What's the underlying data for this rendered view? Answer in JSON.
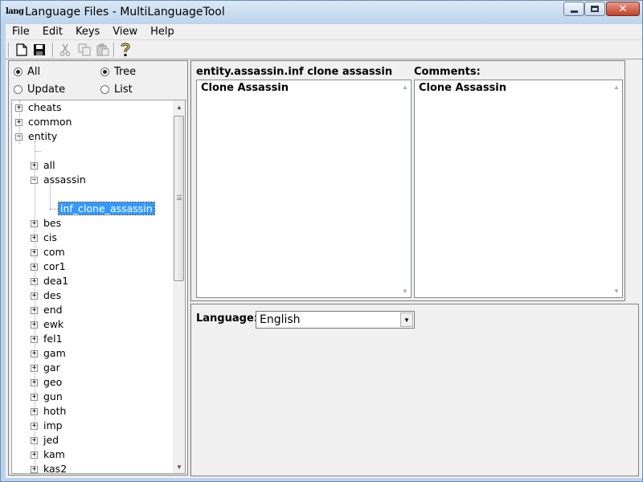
{
  "window": {
    "icon_text": "lang",
    "title": "Language Files - MultiLanguageTool",
    "controls": [
      "minimize-icon",
      "maximize-icon",
      "close-icon"
    ]
  },
  "menu": [
    "File",
    "Edit",
    "Keys",
    "View",
    "Help"
  ],
  "toolbar": {
    "buttons": [
      {
        "name": "new-icon",
        "enabled": true
      },
      {
        "name": "save-icon",
        "enabled": true
      },
      {
        "name": "cut-icon",
        "enabled": false
      },
      {
        "name": "copy-icon",
        "enabled": false
      },
      {
        "name": "paste-icon",
        "enabled": false
      },
      {
        "name": "help-icon",
        "enabled": true
      }
    ]
  },
  "filters": {
    "all": {
      "label": "All",
      "checked": true
    },
    "update": {
      "label": "Update",
      "checked": false
    },
    "tree": {
      "label": "Tree",
      "checked": true
    },
    "list": {
      "label": "List",
      "checked": false
    }
  },
  "tree": {
    "top_nodes": [
      {
        "label": "cheats",
        "expander": "+"
      },
      {
        "label": "common",
        "expander": "+"
      },
      {
        "label": "entity",
        "expander": "−"
      }
    ],
    "entity_children_before": [
      {
        "label": "all",
        "expander": "+"
      },
      {
        "label": "assassin",
        "expander": "−"
      }
    ],
    "selected_leaf": "inf_clone_assassin",
    "entity_children_after": [
      "bes",
      "cis",
      "com",
      "cor1",
      "dea1",
      "des",
      "end",
      "ewk",
      "fel1",
      "gam",
      "gar",
      "geo",
      "gun",
      "hoth",
      "imp",
      "jed",
      "kam",
      "kas2"
    ]
  },
  "editor": {
    "key_label": "entity.assassin.inf  clone  assassin",
    "key_value": "Clone Assassin",
    "comments_label": "Comments:",
    "comments_value": "Clone Assassin"
  },
  "language": {
    "label": "Language:",
    "selected": "English"
  },
  "colors": {
    "selection": "#3399ff",
    "title_bar": "#bcd3ea",
    "close_button": "#c4412a"
  }
}
